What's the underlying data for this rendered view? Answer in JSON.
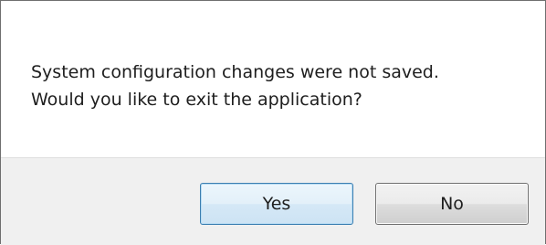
{
  "dialog": {
    "message_lines": [
      "System configuration changes were not saved.",
      "Would you like to exit the application?"
    ],
    "buttons": {
      "yes_label": "Yes",
      "no_label": "No"
    }
  },
  "colors": {
    "default_button_border": "#3c7fb1",
    "button_bar_background": "#f0f0f0",
    "text": "#1e1e1e"
  }
}
